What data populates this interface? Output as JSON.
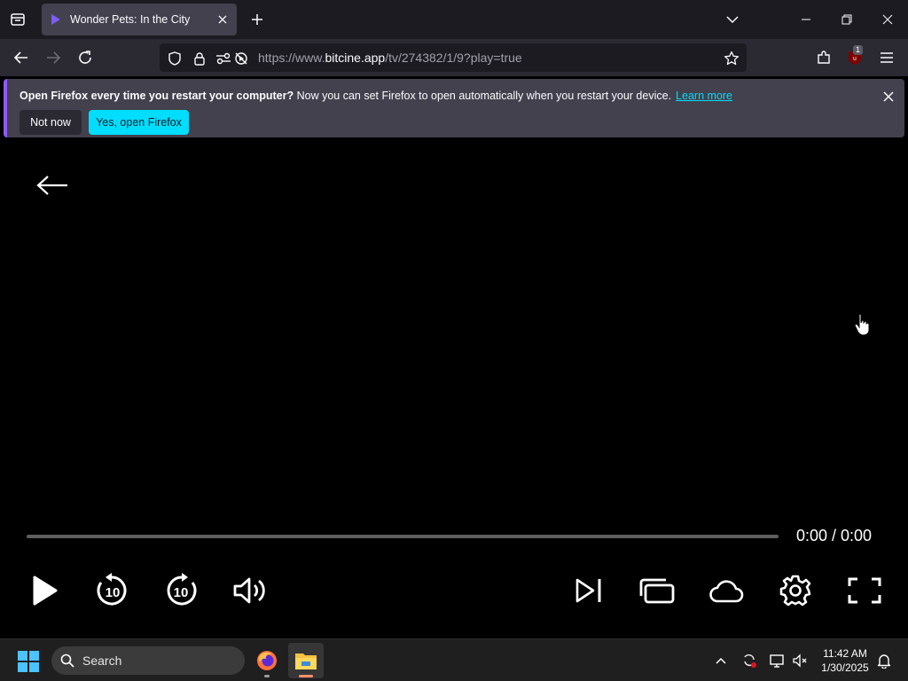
{
  "browser": {
    "tab": {
      "title": "Wonder Pets: In the City"
    },
    "url": {
      "prefix": "https://www.",
      "host": "bitcine.app",
      "path": "/tv/274382/1/9?play=true"
    },
    "extension_badge": "1"
  },
  "notification": {
    "title": "Open Firefox every time you restart your computer?",
    "message": "Now you can set Firefox to open automatically when you restart your device.",
    "link": "Learn more",
    "not_now": "Not now",
    "yes": "Yes, open Firefox"
  },
  "player": {
    "time": "0:00 / 0:00",
    "progress": 0,
    "rewind_seconds": "10",
    "forward_seconds": "10"
  },
  "taskbar": {
    "search_label": "Search",
    "time": "11:42 AM",
    "date": "1/30/2025"
  },
  "colors": {
    "accent": "#00ddff",
    "tab_bg": "#42414d",
    "frame_bg": "#1c1b22",
    "toolbar_bg": "#2b2a33",
    "notify_stripe": "#9059ff"
  }
}
